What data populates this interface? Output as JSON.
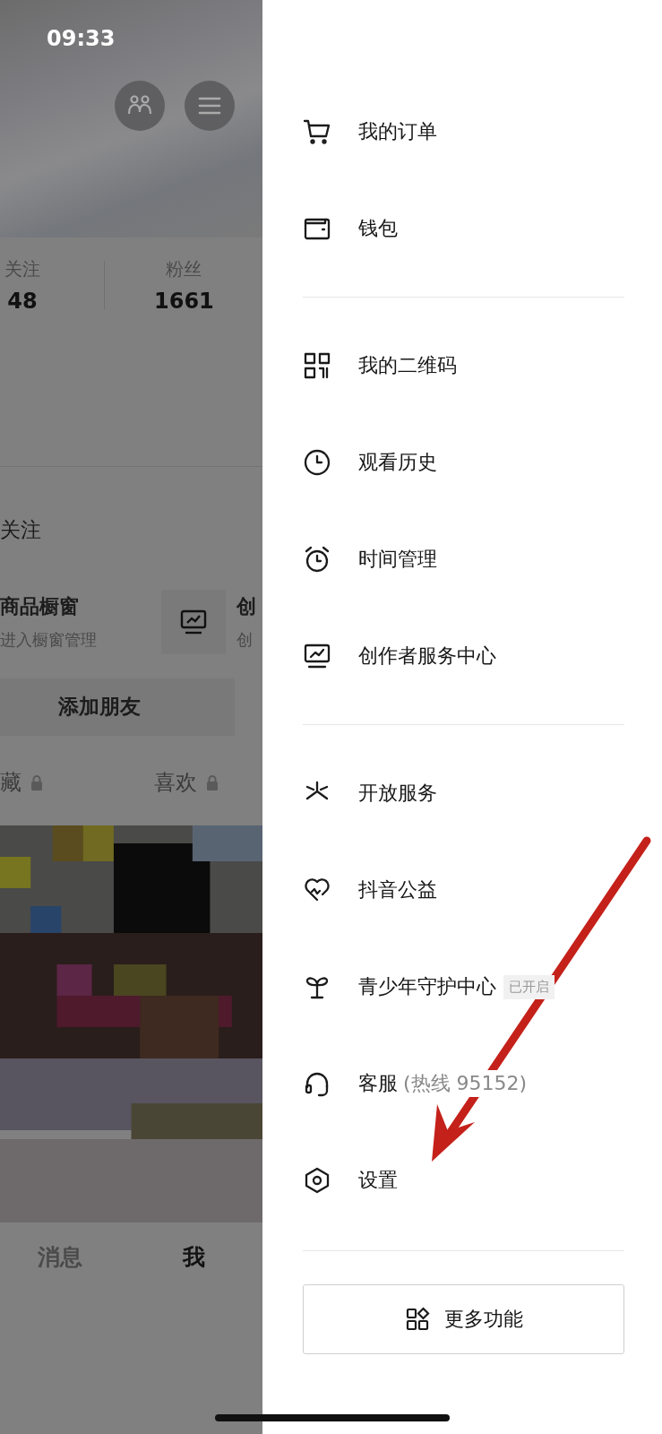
{
  "status_bar": {
    "time": "09:33"
  },
  "profile": {
    "stats": [
      {
        "label": "关注",
        "value": "48"
      },
      {
        "label": "粉丝",
        "value": "1661"
      }
    ],
    "follow_text": "关注",
    "services": [
      {
        "title": "商品橱窗",
        "subtitle": "进入橱窗管理"
      },
      {
        "title": "创",
        "subtitle": "创"
      }
    ],
    "add_friend_button": "添加朋友",
    "tabs": [
      {
        "label": "藏",
        "locked": true
      },
      {
        "label": "喜欢",
        "locked": true
      }
    ]
  },
  "bottom_nav": [
    {
      "label": "消息",
      "selected": false
    },
    {
      "label": "我",
      "selected": true
    }
  ],
  "menu": {
    "groups": [
      [
        {
          "label": "我的订单"
        },
        {
          "label": "钱包"
        }
      ],
      [
        {
          "label": "我的二维码"
        },
        {
          "label": "观看历史"
        },
        {
          "label": "时间管理"
        },
        {
          "label": "创作者服务中心"
        }
      ],
      [
        {
          "label": "开放服务"
        },
        {
          "label": "抖音公益"
        },
        {
          "label": "青少年守护中心",
          "badge": "已开启"
        },
        {
          "label": "客服",
          "note": "(热线 95152)"
        },
        {
          "label": "设置"
        }
      ]
    ],
    "more_button": {
      "label": "更多功能"
    }
  },
  "annotation": {
    "kind": "arrow"
  }
}
